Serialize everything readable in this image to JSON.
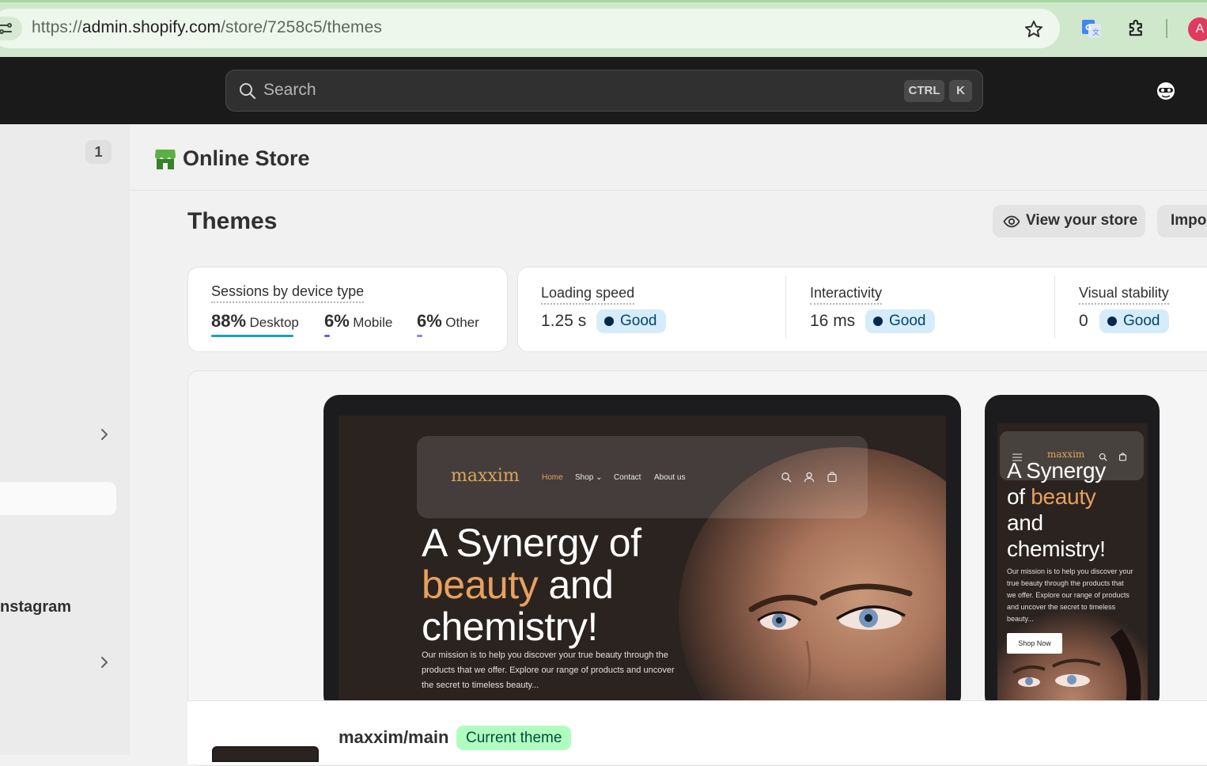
{
  "browser": {
    "url_prefix": "https://",
    "url_host": "admin.shopify.com",
    "url_path": "/store/7258c5/themes",
    "profile_initial": "A"
  },
  "topbar": {
    "search_placeholder": "Search",
    "shortcut_ctrl": "CTRL",
    "shortcut_k": "K"
  },
  "sidebar": {
    "badge_count": "1",
    "instagram_label": "nstagram"
  },
  "header": {
    "store_title": "Online Store"
  },
  "page": {
    "title": "Themes",
    "view_store_label": "View your store",
    "import_label": "Impor"
  },
  "sessions": {
    "label": "Sessions by device type",
    "devices": [
      {
        "pct": "88%",
        "name": "Desktop",
        "share": 0.88,
        "color": "#1c9fc4"
      },
      {
        "pct": "6%",
        "name": "Mobile",
        "share": 0.06,
        "color": "#6b5fd4"
      },
      {
        "pct": "6%",
        "name": "Other",
        "share": 0.06,
        "color": "#8c7fe8"
      }
    ]
  },
  "metrics": [
    {
      "label": "Loading speed",
      "value": "1.25 s",
      "status": "Good"
    },
    {
      "label": "Interactivity",
      "value": "16 ms",
      "status": "Good"
    },
    {
      "label": "Visual stability",
      "value": "0",
      "status": "Good"
    }
  ],
  "preview": {
    "logo": "maxxim",
    "nav": {
      "home": "Home",
      "shop": "Shop",
      "contact": "Contact",
      "about": "About us"
    },
    "headline_1": "A Synergy of",
    "headline_accent": "beauty",
    "headline_2": " and",
    "headline_3": "chemistry!",
    "description": "Our mission is to help you discover your true beauty through the products that we offer. Explore our range of products and uncover the secret to timeless beauty...",
    "mobile_headline_1": "A Synergy",
    "mobile_headline_of": "of ",
    "mobile_headline_accent": "beauty",
    "mobile_headline_2": "and",
    "mobile_headline_3": "chemistry!",
    "mobile_description": "Our mission is to help you discover your true beauty through the products that we offer. Explore our range of products and uncover the secret to timeless beauty...",
    "shop_now": "Shop Now"
  },
  "theme": {
    "name": "maxxim/main",
    "badge": "Current theme"
  },
  "colors": {
    "shopify_green": "#affebf",
    "good_badge": "#d6ecfa",
    "accent_orange": "#e8a15e"
  }
}
